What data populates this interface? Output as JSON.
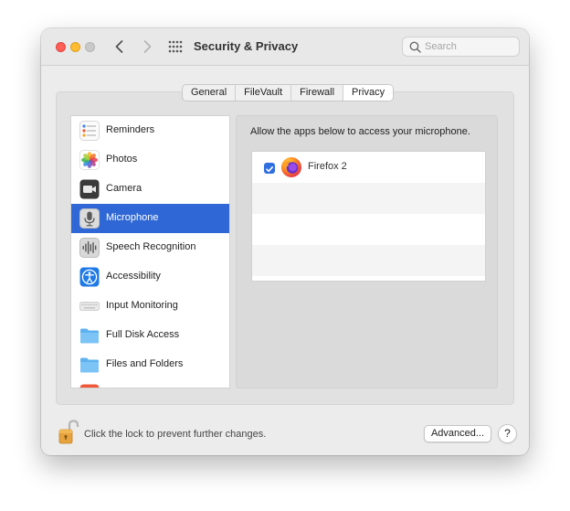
{
  "window": {
    "title": "Security & Privacy",
    "search_placeholder": "Search"
  },
  "tabs": [
    {
      "label": "General",
      "active": false
    },
    {
      "label": "FileVault",
      "active": false
    },
    {
      "label": "Firewall",
      "active": false
    },
    {
      "label": "Privacy",
      "active": true
    }
  ],
  "sidebar": {
    "items": [
      {
        "label": "Reminders",
        "icon": "reminders-icon",
        "selected": false
      },
      {
        "label": "Photos",
        "icon": "photos-icon",
        "selected": false
      },
      {
        "label": "Camera",
        "icon": "camera-icon",
        "selected": false
      },
      {
        "label": "Microphone",
        "icon": "microphone-icon",
        "selected": true
      },
      {
        "label": "Speech Recognition",
        "icon": "speech-recognition-icon",
        "selected": false
      },
      {
        "label": "Accessibility",
        "icon": "accessibility-icon",
        "selected": false
      },
      {
        "label": "Input Monitoring",
        "icon": "keyboard-icon",
        "selected": false
      },
      {
        "label": "Full Disk Access",
        "icon": "folder-icon",
        "selected": false
      },
      {
        "label": "Files and Folders",
        "icon": "folder-icon",
        "selected": false
      }
    ]
  },
  "main": {
    "description": "Allow the apps below to access your microphone.",
    "apps": [
      {
        "name": "Firefox 2",
        "checked": true,
        "icon": "firefox-icon"
      }
    ]
  },
  "footer": {
    "lock_text": "Click the lock to prevent further changes.",
    "advanced_label": "Advanced...",
    "help_label": "?"
  },
  "colors": {
    "selection": "#2f68d6",
    "checkbox": "#2f6fe0",
    "close": "#ff5f57",
    "minimize": "#febc2e"
  }
}
